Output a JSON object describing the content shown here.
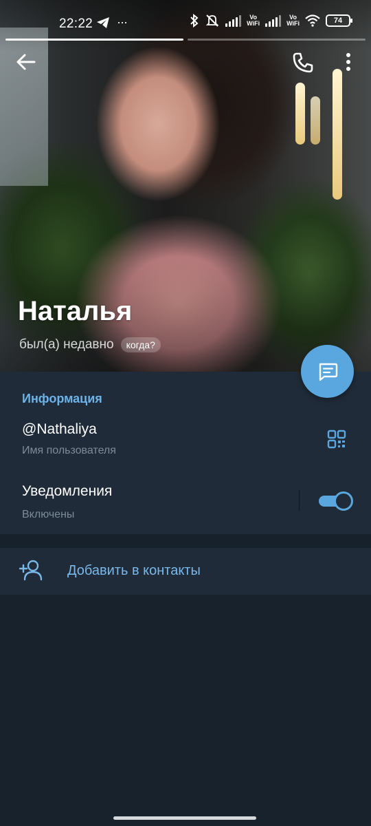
{
  "status_bar": {
    "time": "22:22",
    "telegram_icon": "telegram-icon",
    "more_notifications": "···",
    "vowifi_1": "Vo\nWiFi",
    "vowifi_2": "Vo\nWiFi",
    "battery": "74"
  },
  "profile": {
    "photo": "profile-photo",
    "name": "Наталья",
    "last_seen": "был(а) недавно",
    "last_seen_hint": "когда?"
  },
  "info": {
    "section_title": "Информация",
    "username": "@Nathaliya",
    "username_label": "Имя пользователя",
    "notifications_title": "Уведомления",
    "notifications_state": "Включены",
    "notifications_enabled": true
  },
  "actions": {
    "add_contact": "Добавить в контакты"
  },
  "colors": {
    "accent": "#5aa6df",
    "background": "#1d2733",
    "card": "#1f2b38",
    "link": "#7ab8ea",
    "section_title": "#6cb3ea"
  }
}
